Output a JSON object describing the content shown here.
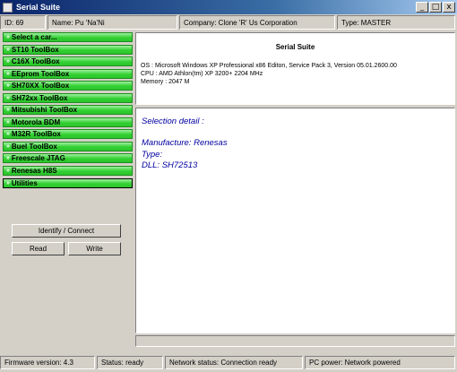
{
  "window": {
    "title": "Serial Suite",
    "icon": "app-icon",
    "buttons": [
      "_",
      "□",
      "x"
    ]
  },
  "infobar": {
    "id": "ID: 69",
    "name": "Name: Pu 'Na'Ni",
    "company": "Company: Clone 'R' Us Corporation",
    "type": "Type: MASTER"
  },
  "sidebar": {
    "items": [
      {
        "label": "Select a car..."
      },
      {
        "label": "ST10 ToolBox"
      },
      {
        "label": "C16X ToolBox"
      },
      {
        "label": "EEprom ToolBox"
      },
      {
        "label": "SH70XX ToolBox"
      },
      {
        "label": "SH72xx ToolBox"
      },
      {
        "label": "Mitsubishi ToolBox"
      },
      {
        "label": "Motorola BDM"
      },
      {
        "label": "M32R ToolBox"
      },
      {
        "label": "Buel ToolBox"
      },
      {
        "label": "Freescale JTAG"
      },
      {
        "label": "Renesas H8S"
      },
      {
        "label": "Utilities"
      }
    ],
    "selected_index": 12,
    "accent_color": "#32d032"
  },
  "buttons": {
    "identify": "Identify / Connect",
    "read": "Read",
    "write": "Write"
  },
  "info_panel": {
    "title": "Serial Suite",
    "os": "OS : Microsoft Windows XP Professional x86 Editon, Service Pack 3, Version 05.01.2600.00",
    "cpu": "CPU : AMD Athlon(tm) XP 3200+ 2204 MHz",
    "memory": "Memory : 2047 M"
  },
  "detail_panel": {
    "heading": "Selection detail :",
    "manufacture": "Manufacture: Renesas",
    "type": "Type:",
    "dll": "DLL: SH72513",
    "text_color": "#0000a0"
  },
  "statusbar": {
    "firmware": "Firmware version: 4.3",
    "status": "Status: ready",
    "network": "Network status: Connection ready",
    "power": "PC power: Network powered"
  }
}
